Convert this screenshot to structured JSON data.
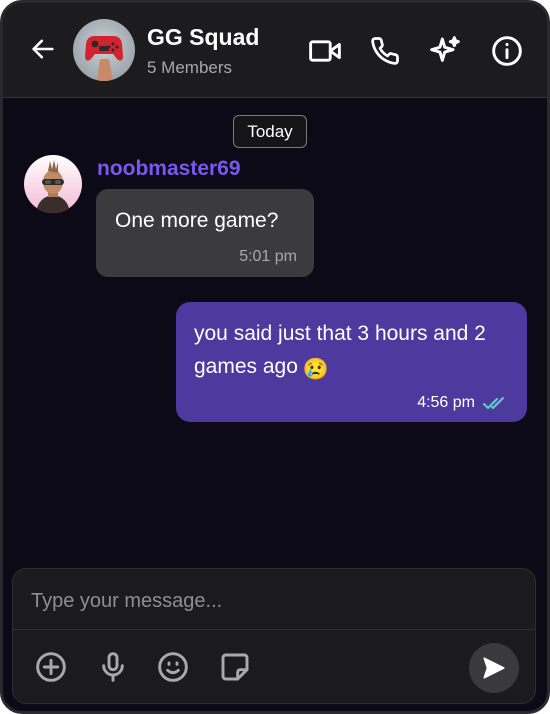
{
  "header": {
    "title": "GG Squad",
    "members": "5 Members",
    "icons": [
      "back-arrow-icon",
      "video-camera-icon",
      "phone-icon",
      "sparkles-icon",
      "info-icon"
    ]
  },
  "day_separator": "Today",
  "messages": [
    {
      "direction": "incoming",
      "sender": "noobmaster69",
      "text": "One more game?",
      "time": "5:01 pm"
    },
    {
      "direction": "outgoing",
      "text": "you said just that 3 hours and 2 games ago",
      "emoji": "😢",
      "time": "4:56 pm",
      "status": "read"
    }
  ],
  "composer": {
    "placeholder": "Type your message...",
    "tools": [
      "add-icon",
      "microphone-icon",
      "emoji-icon",
      "sticker-icon"
    ],
    "send_icon": "send-icon"
  },
  "colors": {
    "background": "#0c0a17",
    "header": "#1c1c1e",
    "incoming_bubble": "#3b3b3d",
    "outgoing_bubble": "#4d3a9e",
    "sender_name": "#7a58f0",
    "read_ticks": "#5fd1c1"
  }
}
